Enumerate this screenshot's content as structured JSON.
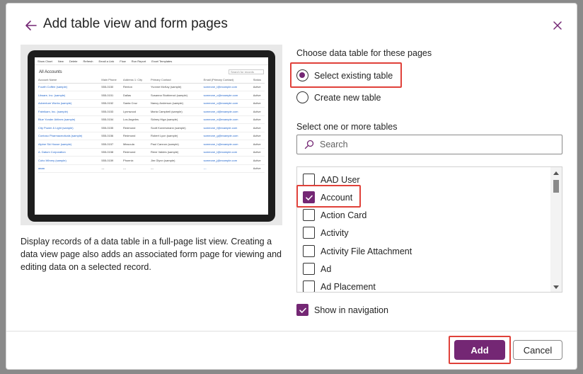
{
  "dialog": {
    "title": "Add table view and form pages",
    "description": "Display records of a data table in a full-page list view. Creating a data view page also adds an associated form page for viewing and editing data on a selected record."
  },
  "preview": {
    "commands": [
      "Show Chart",
      "New",
      "Delete",
      "Refresh",
      "Email a Link",
      "Flow",
      "Run Report",
      "Excel Templates"
    ],
    "view_name": "All Accounts",
    "search_placeholder": "Search for records",
    "columns": [
      "Account Name",
      "Main Phone",
      "Address 1: City",
      "Primary Contact",
      "Email (Primary Contact)",
      "Status"
    ],
    "rows": [
      [
        "Fourth Coffee (sample)",
        "555-0150",
        "Renton",
        "Yvonne McKay (sample)",
        "someone_i@example.com",
        "Active"
      ],
      [
        "Litware, Inc. (sample)",
        "555-0151",
        "Dallas",
        "Susanna Stubberod (sample)",
        "someone_c@example.com",
        "Active"
      ],
      [
        "Adventure Works (sample)",
        "555-0152",
        "Santa Cruz",
        "Nancy Anderson (sample)",
        "someone_c@example.com",
        "Active"
      ],
      [
        "Fabrikam, Inc. (sample)",
        "555-0153",
        "Lynnwood",
        "Maria Campbell (sample)",
        "someone_d@example.com",
        "Active"
      ],
      [
        "Blue Yonder Airlines (sample)",
        "555-0154",
        "Los Angeles",
        "Sidney Higa (sample)",
        "someone_e@example.com",
        "Active"
      ],
      [
        "City Power & Light (sample)",
        "555-0155",
        "Redmond",
        "Scott Konersmann (sample)",
        "someone_f@example.com",
        "Active"
      ],
      [
        "Contoso Pharmaceuticals (sample)",
        "555-0156",
        "Redmond",
        "Robert Lyon (sample)",
        "someone_g@example.com",
        "Active"
      ],
      [
        "Alpine Ski House (sample)",
        "555-0157",
        "Missoula",
        "Paul Cannon (sample)",
        "someone_h@example.com",
        "Active"
      ],
      [
        "A. Datum Corporation",
        "555-0158",
        "Redmond",
        "Rene Valdes (sample)",
        "someone_i@example.com",
        "Active"
      ],
      [
        "Coho Winery (sample)",
        "555-0159",
        "Phoenix",
        "Jim Glynn (sample)",
        "someone_j@example.com",
        "Active"
      ],
      [
        "aaaa",
        "---",
        "---",
        "---",
        "---",
        "Active"
      ]
    ]
  },
  "choose": {
    "label": "Choose data table for these pages",
    "options": [
      "Select existing table",
      "Create new table"
    ],
    "selected": "Select existing table"
  },
  "tables": {
    "label": "Select one or more tables",
    "search_placeholder": "Search",
    "items": [
      {
        "label": "AAD User",
        "checked": false
      },
      {
        "label": "Account",
        "checked": true
      },
      {
        "label": "Action Card",
        "checked": false
      },
      {
        "label": "Activity",
        "checked": false
      },
      {
        "label": "Activity File Attachment",
        "checked": false
      },
      {
        "label": "Ad",
        "checked": false
      },
      {
        "label": "Ad Placement",
        "checked": false
      }
    ]
  },
  "navigation": {
    "label": "Show in navigation",
    "checked": true
  },
  "buttons": {
    "add": "Add",
    "cancel": "Cancel"
  },
  "colors": {
    "accent": "#742774",
    "highlight": "#e0413a",
    "link": "#2266cc"
  },
  "icons": {
    "back": "arrow-left-icon",
    "close": "close-icon",
    "search": "search-icon",
    "check": "checkmark-icon"
  }
}
